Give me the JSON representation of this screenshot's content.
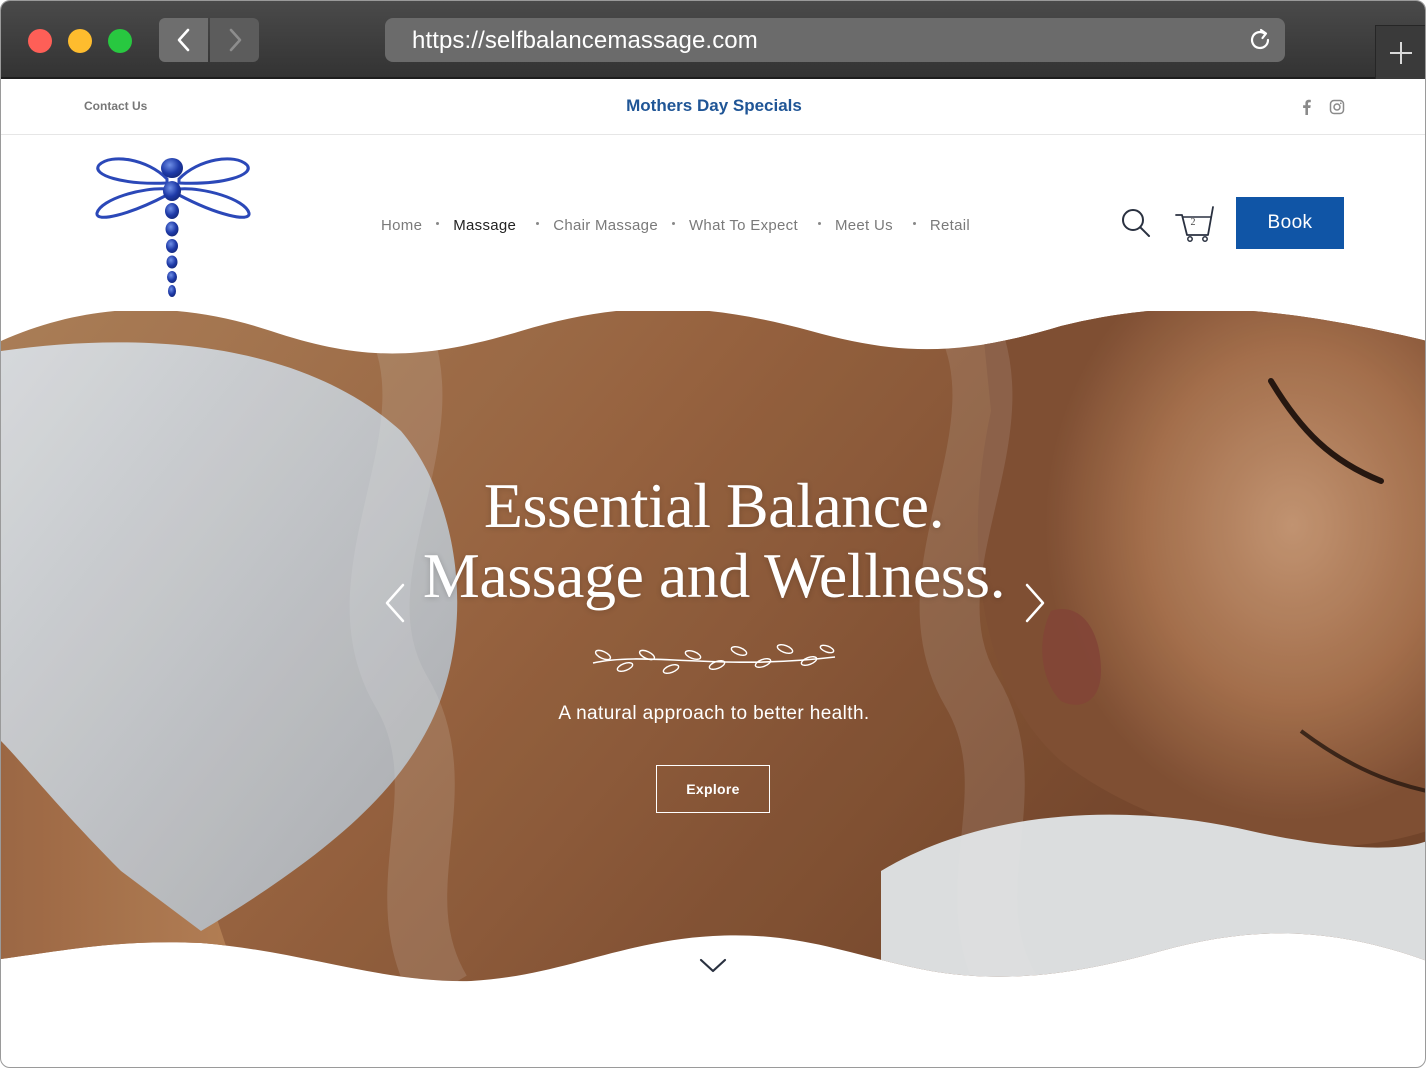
{
  "browser": {
    "url": "https://selfbalancemassage.com"
  },
  "topbar": {
    "contact_label": "Contact Us",
    "specials_label": "Mothers Day Specials",
    "social": [
      "facebook-icon",
      "instagram-icon"
    ]
  },
  "nav": {
    "items": [
      {
        "label": "Home"
      },
      {
        "label": "Massage"
      },
      {
        "label": "Chair Massage"
      },
      {
        "label": "What To Expect"
      },
      {
        "label": "Meet Us"
      },
      {
        "label": "Retail"
      }
    ],
    "active": "Massage",
    "cart_count": "2",
    "book_label": "Book"
  },
  "hero": {
    "title_line1": "Essential Balance.",
    "title_line2": "Massage and Wellness.",
    "subtitle": "A natural approach to better health.",
    "button_label": "Explore"
  },
  "colors": {
    "brand_blue": "#1055a6",
    "specials_blue": "#1f5596",
    "nav_text": "#7a7a7a"
  }
}
